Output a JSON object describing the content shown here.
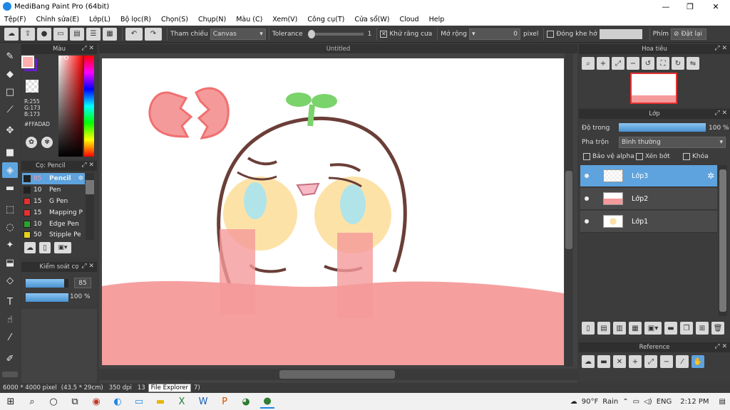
{
  "window": {
    "title": "MediBang Paint Pro (64bit)",
    "minimize": "—",
    "maximize": "❐",
    "close": "✕"
  },
  "menu": [
    "Tệp(F)",
    "Chỉnh sửa(E)",
    "Lớp(L)",
    "Bộ lọc(R)",
    "Chọn(S)",
    "Chụp(N)",
    "Màu (C)",
    "Xem(V)",
    "Công cụ(T)",
    "Cửa sổ(W)",
    "Cloud",
    "Help"
  ],
  "toolbar": {
    "reference_label": "Tham chiếu",
    "reference_value": "Canvas",
    "tolerance_label": "Tolerance",
    "tolerance_value": "1",
    "antialias_label": "Khử răng cưa",
    "expand_label": "Mở rộng",
    "expand_value": "0",
    "expand_unit": "pixel",
    "gap_label": "Đóng khe hở",
    "key_label": "Phím",
    "reset_label": "Đặt lại",
    "antialias_check": "✕"
  },
  "color_panel": {
    "title": "Màu",
    "r": "R:255",
    "g": "G:173",
    "b": "B:173",
    "hex": "#FFADAD",
    "fg_color": "#ffadad",
    "bg_color": "#6a1fd0"
  },
  "brush_panel": {
    "title": "Cọ: Pencil",
    "brushes": [
      {
        "size": "85",
        "name": "Pencil",
        "color": "#222222"
      },
      {
        "size": "10",
        "name": "Pen",
        "color": "#222222"
      },
      {
        "size": "15",
        "name": "G Pen",
        "color": "#e53030"
      },
      {
        "size": "15",
        "name": "Mapping P",
        "color": "#e53030"
      },
      {
        "size": "10",
        "name": "Edge Pen",
        "color": "#2aa52a"
      },
      {
        "size": "50",
        "name": "Stipple Pe",
        "color": "#e6d21e"
      }
    ]
  },
  "brush_control": {
    "title": "Kiểm soát cọ",
    "size": "85",
    "opacity": "100 %",
    "size_fraction": 0.9,
    "opacity_fraction": 1.0
  },
  "canvas": {
    "tab": "Untitled"
  },
  "navigator": {
    "title": "Hoa tiêu"
  },
  "layers": {
    "title": "Lớp",
    "opacity_label": "Độ trong",
    "opacity_value": "100 %",
    "opacity_fraction": 1.0,
    "blend_label": "Pha trộn",
    "blend_value": "Bình thường",
    "protect_alpha": "Bảo vệ alpha",
    "clipping": "Xén bớt",
    "lock": "Khóa",
    "items": [
      {
        "name": "Lớp3"
      },
      {
        "name": "Lớp2"
      },
      {
        "name": "Lớp1"
      }
    ]
  },
  "reference": {
    "title": "Reference"
  },
  "status": {
    "size": "6000 * 4000 pixel",
    "cm": "(43.5 * 29cm)",
    "dpi": "350 dpi",
    "zoom_partial": "13",
    "tooltip": "File Explorer",
    "tail": "7)"
  },
  "taskbar": {
    "weather": "90°F",
    "weather_desc": "Rain",
    "lang": "ENG",
    "time": "2:12 PM"
  }
}
